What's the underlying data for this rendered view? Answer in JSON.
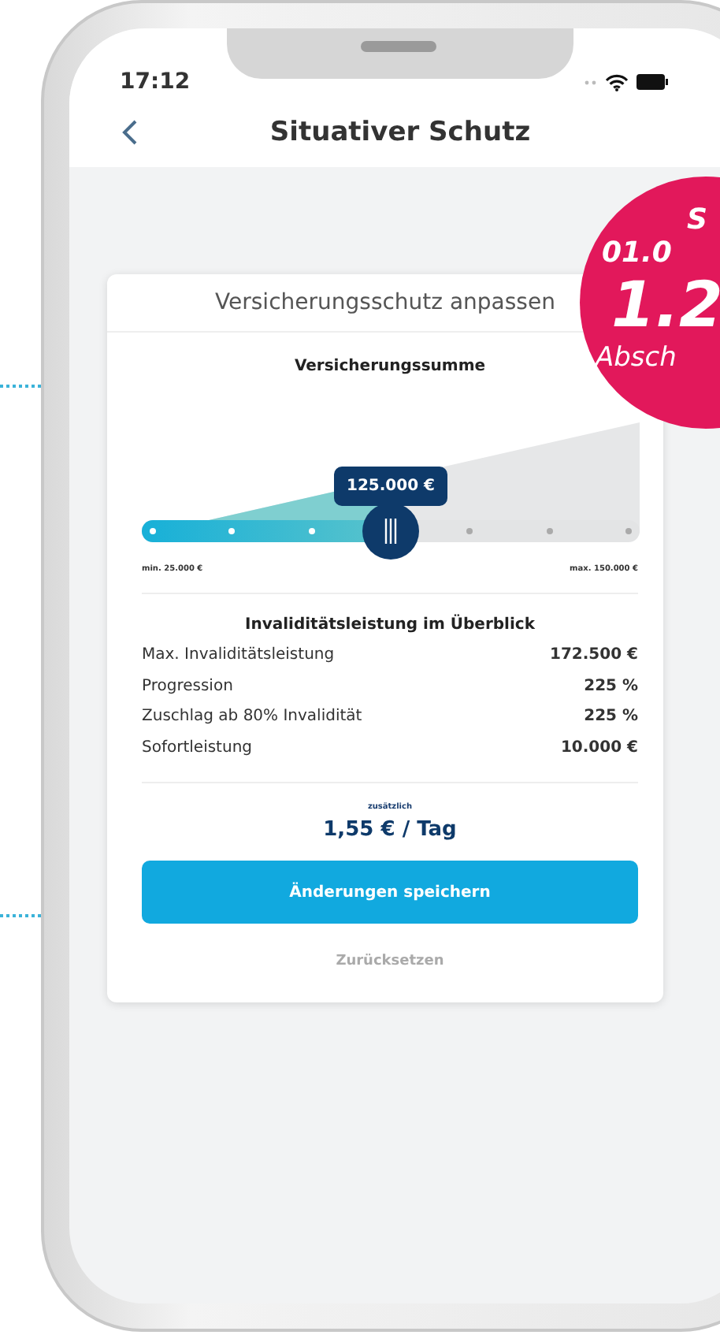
{
  "status_bar": {
    "time": "17:12"
  },
  "nav": {
    "title": "Situativer Schutz"
  },
  "card": {
    "title": "Versicherungsschutz anpassen",
    "slider": {
      "label": "Versicherungssumme",
      "value": "125.000 €",
      "level": 0.5,
      "min_label": "min. 25.000 €",
      "max_label": "max. 150.000 €"
    },
    "overview": {
      "title": "Invaliditätsleistung im Überblick",
      "rows": [
        {
          "label": "Max. Invaliditätsleistung",
          "value": "172.500 €"
        },
        {
          "label": "Progression",
          "value": "225 %"
        },
        {
          "label": "Zuschlag ab 80% Invalidität",
          "value": "225 %"
        },
        {
          "label": "Sofortleistung",
          "value": "10.000 €"
        }
      ]
    },
    "price": {
      "caption": "zusätzlich",
      "amount": "1,55 € / Tag"
    },
    "save_button": "Änderungen speichern",
    "reset_link": "Zurücksetzen"
  },
  "badge": {
    "lines": [
      "S",
      "01.0",
      "1.2",
      "Absch"
    ]
  }
}
